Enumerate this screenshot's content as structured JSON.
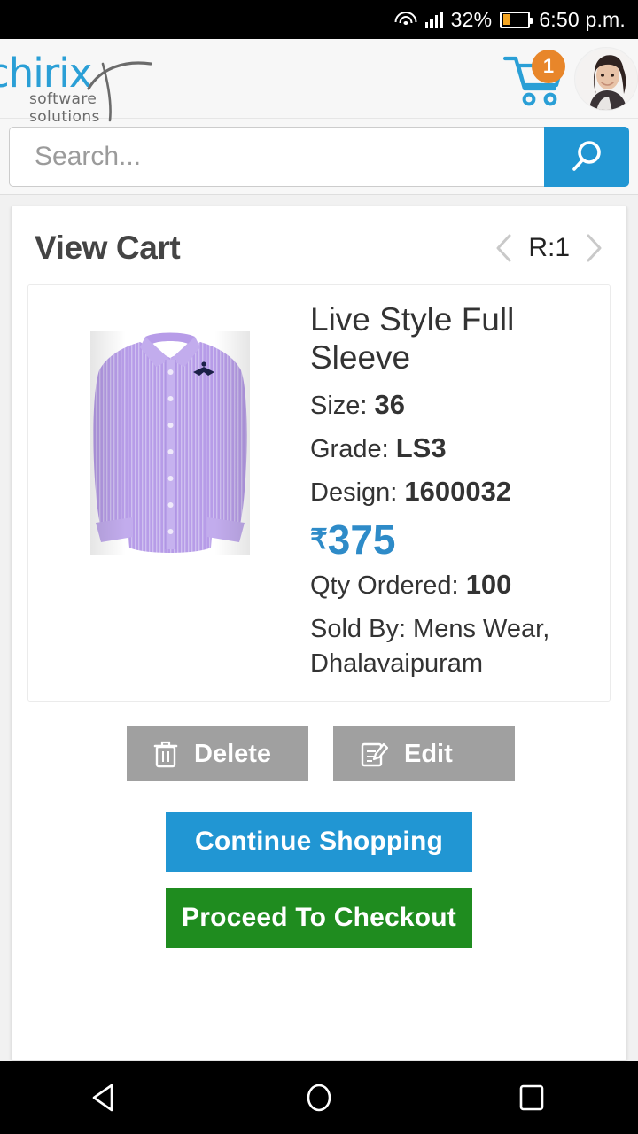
{
  "status_bar": {
    "wifi_icon": "wifi-icon",
    "signal_icon": "signal-icon",
    "battery_percent": "32%",
    "battery_icon": "battery-icon",
    "battery_level": 32,
    "battery_color": "#f5a623",
    "time": "6:50 p.m."
  },
  "header": {
    "logo_text": "chirix",
    "logo_subtitle": "software solutions",
    "logo_color": "#2a9fd6",
    "cart_icon": "shopping-cart-icon",
    "cart_badge_count": "1",
    "cart_badge_color": "#e8862a",
    "cart_color": "#2a9fd6",
    "avatar_icon": "user-avatar"
  },
  "search": {
    "placeholder": "Search...",
    "value": "",
    "button_icon": "search-icon",
    "button_color": "#2196d3"
  },
  "cart_panel": {
    "title": "View Cart",
    "pager": {
      "prev_icon": "chevron-left-icon",
      "label": "R:1",
      "next_icon": "chevron-right-icon"
    }
  },
  "product": {
    "image_alt": "purple-striped-full-sleeve-shirt",
    "name": "Live Style Full Sleeve",
    "fields": [
      {
        "label": "Size:",
        "value": "36"
      },
      {
        "label": "Grade:",
        "value": "LS3"
      },
      {
        "label": "Design:",
        "value": "1600032"
      }
    ],
    "currency_symbol": "₹",
    "price": "375",
    "price_color": "#2e8bc8",
    "qty_label": "Qty Ordered:",
    "qty_value": "100",
    "sold_by_label": "Sold By:",
    "sold_by_value": "Mens Wear, Dhalavaipuram",
    "sold_by_line1": "Sold By:  Mens Wear,",
    "sold_by_line2": "Dhalavaipuram",
    "delete_button": {
      "label": "Delete",
      "icon": "trash-icon"
    },
    "edit_button": {
      "label": "Edit",
      "icon": "edit-pencil-icon"
    },
    "button_color": "#a0a0a0"
  },
  "footer_actions": {
    "continue_shopping": "Continue Shopping",
    "continue_color": "#2196d3",
    "checkout": "Proceed To Checkout",
    "checkout_color": "#1f8c1f"
  },
  "nav_bar": {
    "back_icon": "back-triangle-icon",
    "home_icon": "home-circle-icon",
    "recents_icon": "recents-square-icon"
  }
}
